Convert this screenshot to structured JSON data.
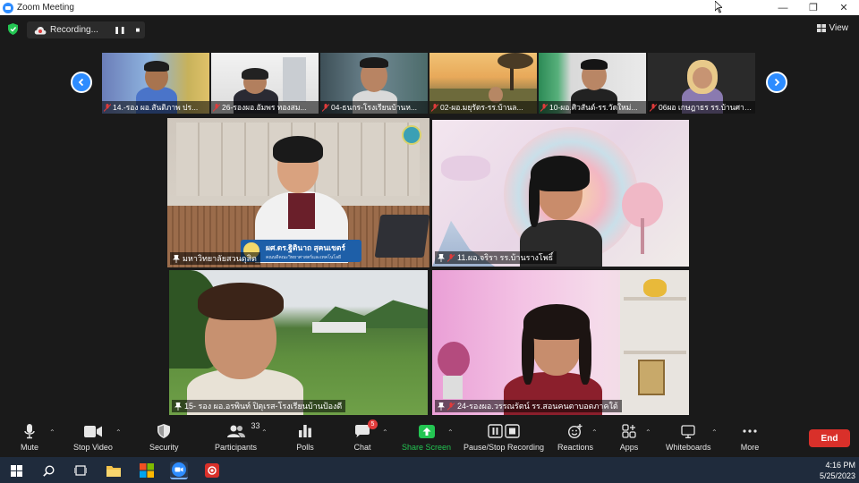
{
  "window": {
    "title": "Zoom Meeting"
  },
  "topbar": {
    "recording_label": "Recording...",
    "view_label": "View"
  },
  "strip": {
    "participants": [
      {
        "name": "14.-รอง ผอ.สันติภาพ ปร..."
      },
      {
        "name": "26-รองผอ.อัมพร ทองสม..."
      },
      {
        "name": "04-ธนกร-โรงเรียนบ้านห..."
      },
      {
        "name": "02-ผอ.มยุรัตร-รร.บ้านล..."
      },
      {
        "name": "10-ผอ.ศิวสันต์-รร.วัดใหม่..."
      },
      {
        "name": "06ผอ เกษฎาธร รร.บ้านศาล..."
      }
    ]
  },
  "gallery": {
    "tiles": [
      {
        "name": "มหาวิทยาลัยสวนดุสิต",
        "banner_name": "ผศ.ดร.ฐิตินาถ สุคนเขตร์",
        "banner_sub": "คณบดีคณะวิทยาศาสตร์และเทคโนโลยี"
      },
      {
        "name": "11.ผอ.จริรา รร.บ้านรางโพธิ์"
      },
      {
        "name": "15- รอง ผอ.อรพินท์ ปิตุเรส-โรงเรียนบ้านป้องดี"
      },
      {
        "name": "24-รองผอ.วรรณรัตน์ รร.สอนคนตาบอดภาคใต้"
      }
    ]
  },
  "toolbar": {
    "mute": "Mute",
    "stop_video": "Stop Video",
    "security": "Security",
    "participants": "Participants",
    "participants_count": "33",
    "polls": "Polls",
    "chat": "Chat",
    "chat_badge": "5",
    "share_screen": "Share Screen",
    "pause_recording": "Pause/Stop Recording",
    "reactions": "Reactions",
    "apps": "Apps",
    "whiteboards": "Whiteboards",
    "more": "More",
    "end": "End"
  },
  "taskbar": {
    "time": "4:16 PM",
    "date": "5/25/2023"
  },
  "colors": {
    "accent": "#2d8cff",
    "active_speaker": "#c6e26b",
    "end": "#d9302a",
    "share": "#23c552"
  }
}
